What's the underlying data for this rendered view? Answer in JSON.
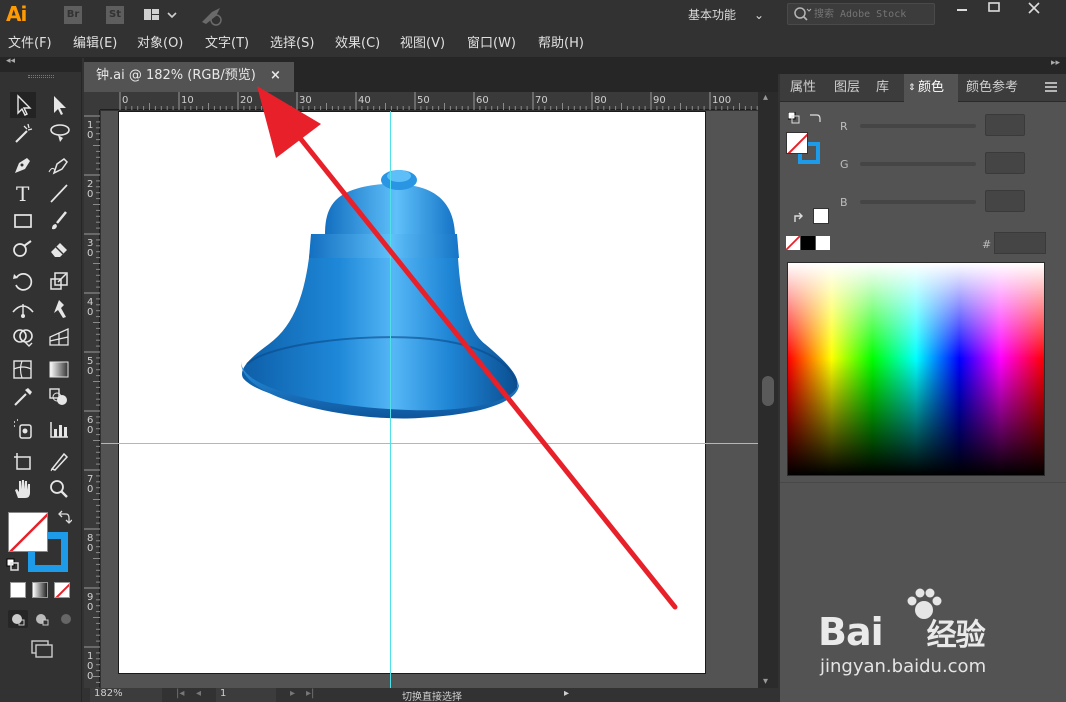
{
  "app": {
    "logo": "Ai",
    "bridge_label": "Br",
    "stock_label": "St",
    "workspace_label": "基本功能",
    "search_placeholder": "搜索 Adobe Stock"
  },
  "menubar": {
    "items": [
      "文件(F)",
      "编辑(E)",
      "对象(O)",
      "文字(T)",
      "选择(S)",
      "效果(C)",
      "视图(V)",
      "窗口(W)",
      "帮助(H)"
    ]
  },
  "document": {
    "tab_title": "钟.ai @ 182% (RGB/预览)",
    "close_glyph": "×"
  },
  "ruler": {
    "h_labels": [
      "0",
      "10",
      "20",
      "30",
      "40",
      "50",
      "60",
      "70",
      "80",
      "90",
      "100"
    ],
    "v_labels": [
      "1 0",
      "2 0",
      "3 0",
      "4 0",
      "5 0",
      "6 0",
      "7 0",
      "8 0",
      "9 0",
      "1 0 0"
    ]
  },
  "statusbar": {
    "zoom": "182%",
    "page": "1",
    "tool_hint": "切换直接选择"
  },
  "panel": {
    "tabs": [
      "属性",
      "图层",
      "库",
      "颜色",
      "颜色参考"
    ],
    "active_tab": "颜色",
    "channel_labels": [
      "R",
      "G",
      "B"
    ],
    "hex_label": "#",
    "hex_value": ""
  },
  "watermark": {
    "brand": "Bai百经验",
    "logo_text": "Bai",
    "logo_tail": "经验",
    "url": "jingyan.baidu.com"
  },
  "colors": {
    "app_bg": "#323232",
    "panel_bg": "#535353",
    "bell_blue": "#1e88d8",
    "guide_cyan": "#4fe0e8",
    "arrow_red": "#e8202a",
    "stroke_fill_blue": "#1e9be8"
  },
  "icons": [
    "selection-tool-icon",
    "direct-selection-tool-icon",
    "magic-wand-icon",
    "lasso-icon",
    "pen-tool-icon",
    "curvature-tool-icon",
    "type-tool-icon",
    "line-tool-icon",
    "rectangle-tool-icon",
    "paintbrush-icon",
    "shaper-tool-icon",
    "eraser-icon",
    "rotate-tool-icon",
    "scale-tool-icon",
    "width-tool-icon",
    "puppet-warp-icon",
    "shape-builder-icon",
    "perspective-grid-icon",
    "mesh-tool-icon",
    "gradient-tool-icon",
    "eyedropper-icon",
    "blend-tool-icon",
    "symbol-sprayer-icon",
    "column-graph-icon",
    "artboard-tool-icon",
    "slice-tool-icon",
    "hand-tool-icon",
    "zoom-tool-icon"
  ]
}
